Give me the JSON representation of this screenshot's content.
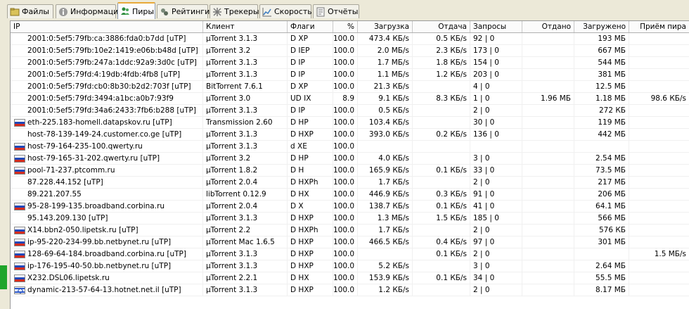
{
  "tabs": [
    {
      "label": "Файлы",
      "icon": "files-icon"
    },
    {
      "label": "Информация",
      "icon": "info-icon"
    },
    {
      "label": "Пиры",
      "icon": "peers-icon",
      "active": true
    },
    {
      "label": "Рейтинги",
      "icon": "ratings-icon"
    },
    {
      "label": "Трекеры",
      "icon": "trackers-icon"
    },
    {
      "label": "Скорость",
      "icon": "speed-icon"
    },
    {
      "label": "Отчёты",
      "icon": "reports-icon"
    }
  ],
  "columns": [
    "IP",
    "Клиент",
    "Флаги",
    "%",
    "Загрузка",
    "Отдача",
    "Запросы",
    "Отдано",
    "Загружено",
    "Приём пира"
  ],
  "peers": [
    {
      "ip": "2001:0:5ef5:79fb:ca:3886:fda0:b7dd [uTP]",
      "flag": "",
      "client": "µTorrent 3.1.3",
      "flags": "D XP",
      "pct": "100.0",
      "down": "473.4 КБ/s",
      "up": "0.5 КБ/s",
      "req": "92 | 0",
      "sent": "",
      "recv": "193 МБ",
      "peer": ""
    },
    {
      "ip": "2001:0:5ef5:79fb:10e2:1419:e06b:b48d [uTP]",
      "flag": "",
      "client": "µTorrent 3.2",
      "flags": "D IEP",
      "pct": "100.0",
      "down": "2.0 МБ/s",
      "up": "2.3 КБ/s",
      "req": "173 | 0",
      "sent": "",
      "recv": "667 МБ",
      "peer": ""
    },
    {
      "ip": "2001:0:5ef5:79fb:247a:1ddc:92a9:3d0c [uTP]",
      "flag": "",
      "client": "µTorrent 3.1.3",
      "flags": "D IP",
      "pct": "100.0",
      "down": "1.7 МБ/s",
      "up": "1.8 КБ/s",
      "req": "154 | 0",
      "sent": "",
      "recv": "544 МБ",
      "peer": ""
    },
    {
      "ip": "2001:0:5ef5:79fd:4:19db:4fdb:4fb8 [uTP]",
      "flag": "",
      "client": "µTorrent 3.1.3",
      "flags": "D IP",
      "pct": "100.0",
      "down": "1.1 МБ/s",
      "up": "1.2 КБ/s",
      "req": "203 | 0",
      "sent": "",
      "recv": "381 МБ",
      "peer": ""
    },
    {
      "ip": "2001:0:5ef5:79fd:cb0:8b30:b2d2:703f [uTP]",
      "flag": "",
      "client": "BitTorrent 7.6.1",
      "flags": "D XP",
      "pct": "100.0",
      "down": "21.3 КБ/s",
      "up": "",
      "req": "4 | 0",
      "sent": "",
      "recv": "12.5 МБ",
      "peer": ""
    },
    {
      "ip": "2001:0:5ef5:79fd:3494:a1bc:a0b7:93f9",
      "flag": "",
      "client": "µTorrent 3.0",
      "flags": "UD IX",
      "pct": "8.9",
      "down": "9.1 КБ/s",
      "up": "8.3 КБ/s",
      "req": "1 | 0",
      "sent": "1.96 МБ",
      "recv": "1.18 МБ",
      "peer": "98.6 КБ/s"
    },
    {
      "ip": "2001:0:5ef5:79fd:34a6:2433:7fb6:b288 [uTP]",
      "flag": "",
      "client": "µTorrent 3.1.3",
      "flags": "D IP",
      "pct": "100.0",
      "down": "0.5 КБ/s",
      "up": "",
      "req": "2 | 0",
      "sent": "",
      "recv": "272 КБ",
      "peer": ""
    },
    {
      "ip": "eth-225.183-homell.datapskov.ru [uTP]",
      "flag": "ru",
      "client": "Transmission 2.60",
      "flags": "D HP",
      "pct": "100.0",
      "down": "103.4 КБ/s",
      "up": "",
      "req": "30 | 0",
      "sent": "",
      "recv": "119 МБ",
      "peer": ""
    },
    {
      "ip": "host-78-139-149-24.customer.co.ge [uTP]",
      "flag": "",
      "client": "µTorrent 3.1.3",
      "flags": "D HXP",
      "pct": "100.0",
      "down": "393.0 КБ/s",
      "up": "0.2 КБ/s",
      "req": "136 | 0",
      "sent": "",
      "recv": "442 МБ",
      "peer": ""
    },
    {
      "ip": "host-79-164-235-100.qwerty.ru",
      "flag": "ru",
      "client": "µTorrent 3.1.3",
      "flags": "d XE",
      "pct": "100.0",
      "down": "",
      "up": "",
      "req": "",
      "sent": "",
      "recv": "",
      "peer": ""
    },
    {
      "ip": "host-79-165-31-202.qwerty.ru [uTP]",
      "flag": "ru",
      "client": "µTorrent 3.2",
      "flags": "D HP",
      "pct": "100.0",
      "down": "4.0 КБ/s",
      "up": "",
      "req": "3 | 0",
      "sent": "",
      "recv": "2.54 МБ",
      "peer": ""
    },
    {
      "ip": "pool-71-237.ptcomm.ru",
      "flag": "ru",
      "client": "µTorrent 1.8.2",
      "flags": "D H",
      "pct": "100.0",
      "down": "165.9 КБ/s",
      "up": "0.1 КБ/s",
      "req": "33 | 0",
      "sent": "",
      "recv": "73.5 МБ",
      "peer": ""
    },
    {
      "ip": "87.228.44.152 [uTP]",
      "flag": "",
      "client": "µTorrent 2.0.4",
      "flags": "D HXPh",
      "pct": "100.0",
      "down": "1.7 КБ/s",
      "up": "",
      "req": "2 | 0",
      "sent": "",
      "recv": "217 МБ",
      "peer": ""
    },
    {
      "ip": "89.221.207.55",
      "flag": "",
      "client": "libTorrent 0.12.9",
      "flags": "D HX",
      "pct": "100.0",
      "down": "446.9 КБ/s",
      "up": "0.3 КБ/s",
      "req": "91 | 0",
      "sent": "",
      "recv": "206 МБ",
      "peer": ""
    },
    {
      "ip": "95-28-199-135.broadband.corbina.ru",
      "flag": "ru",
      "client": "µTorrent 2.0.4",
      "flags": "D X",
      "pct": "100.0",
      "down": "138.7 КБ/s",
      "up": "0.1 КБ/s",
      "req": "41 | 0",
      "sent": "",
      "recv": "64.1 МБ",
      "peer": ""
    },
    {
      "ip": "95.143.209.130 [uTP]",
      "flag": "",
      "client": "µTorrent 3.1.3",
      "flags": "D HXP",
      "pct": "100.0",
      "down": "1.3 МБ/s",
      "up": "1.5 КБ/s",
      "req": "185 | 0",
      "sent": "",
      "recv": "566 МБ",
      "peer": ""
    },
    {
      "ip": "X14.bbn2-050.lipetsk.ru [uTP]",
      "flag": "ru",
      "client": "µTorrent 2.2",
      "flags": "D HXPh",
      "pct": "100.0",
      "down": "1.7 КБ/s",
      "up": "",
      "req": "2 | 0",
      "sent": "",
      "recv": "576 КБ",
      "peer": ""
    },
    {
      "ip": "ip-95-220-234-99.bb.netbynet.ru [uTP]",
      "flag": "ru",
      "client": "µTorrent Mac 1.6.5",
      "flags": "D HXP",
      "pct": "100.0",
      "down": "466.5 КБ/s",
      "up": "0.4 КБ/s",
      "req": "97 | 0",
      "sent": "",
      "recv": "301 МБ",
      "peer": ""
    },
    {
      "ip": "128-69-64-184.broadband.corbina.ru [uTP]",
      "flag": "ru",
      "client": "µTorrent 3.1.3",
      "flags": "D HXP",
      "pct": "100.0",
      "down": "",
      "up": "0.1 КБ/s",
      "req": "2 | 0",
      "sent": "",
      "recv": "",
      "peer": "1.5 МБ/s"
    },
    {
      "ip": "ip-176-195-40-50.bb.netbynet.ru [uTP]",
      "flag": "ru",
      "client": "µTorrent 3.1.3",
      "flags": "D HXP",
      "pct": "100.0",
      "down": "5.2 КБ/s",
      "up": "",
      "req": "3 | 0",
      "sent": "",
      "recv": "2.64 МБ",
      "peer": ""
    },
    {
      "ip": "X232.DSL06.lipetsk.ru",
      "flag": "ru",
      "client": "µTorrent 2.2.1",
      "flags": "D HX",
      "pct": "100.0",
      "down": "153.9 КБ/s",
      "up": "0.1 КБ/s",
      "req": "34 | 0",
      "sent": "",
      "recv": "55.5 МБ",
      "peer": ""
    },
    {
      "ip": "dynamic-213-57-64-13.hotnet.net.il [uTP]",
      "flag": "il",
      "client": "µTorrent 3.1.3",
      "flags": "D HXP",
      "pct": "100.0",
      "down": "1.2 КБ/s",
      "up": "",
      "req": "2 | 0",
      "sent": "",
      "recv": "8.17 МБ",
      "peer": ""
    }
  ]
}
